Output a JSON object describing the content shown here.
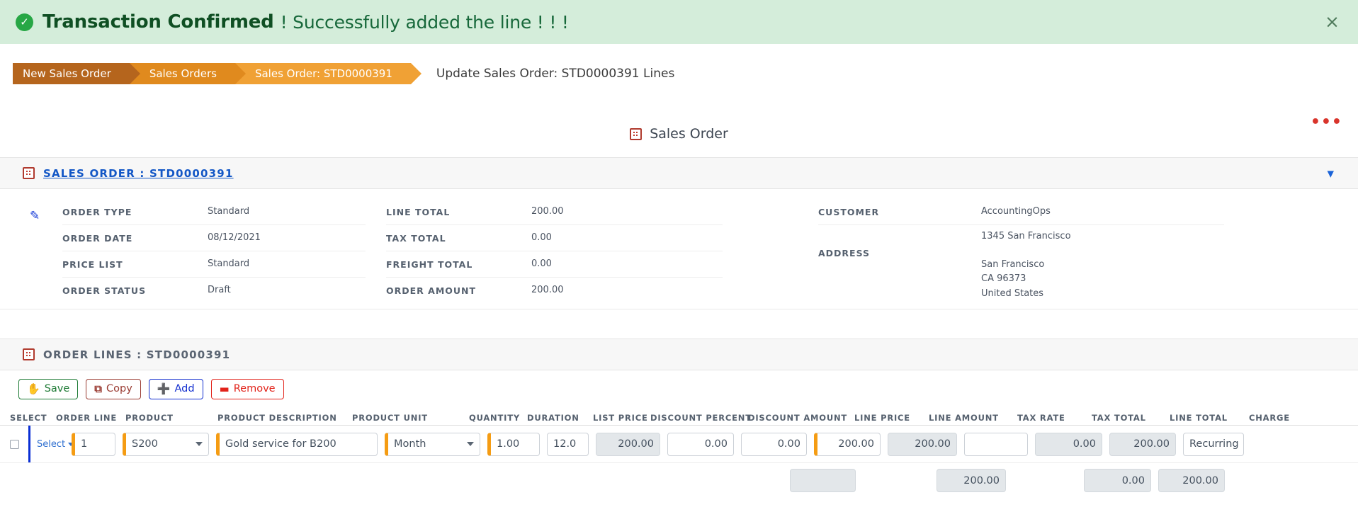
{
  "alert": {
    "icon": "check-circle-icon",
    "strong": "Transaction Confirmed",
    "message": "! Successfully added the line ! ! !",
    "close_label": "×",
    "bg_color": "#d4edda",
    "accent_color": "#27a745"
  },
  "breadcrumb": {
    "items": [
      {
        "label": "New Sales Order",
        "color": "#b5651d"
      },
      {
        "label": "Sales Orders",
        "color": "#e08a1e"
      },
      {
        "label": "Sales Order: STD0000391",
        "color": "#f0a135"
      }
    ],
    "current_page": "Update Sales Order: STD0000391 Lines"
  },
  "overflow_menu": {
    "label": "•••",
    "color": "#d9342b"
  },
  "tab": {
    "icon": "grid-icon",
    "label": "Sales Order"
  },
  "sales_order_card": {
    "icon": "grid-icon",
    "title": "SALES ORDER : STD0000391",
    "collapse_icon": "chevron-down-icon",
    "edit_icon": "pencil-icon",
    "column1": [
      {
        "label": "ORDER TYPE",
        "value": "Standard"
      },
      {
        "label": "ORDER DATE",
        "value": "08/12/2021"
      },
      {
        "label": "PRICE LIST",
        "value": "Standard"
      },
      {
        "label": "ORDER STATUS",
        "value": "Draft"
      }
    ],
    "column2": [
      {
        "label": "LINE TOTAL",
        "value": "200.00"
      },
      {
        "label": "TAX TOTAL",
        "value": "0.00"
      },
      {
        "label": "FREIGHT TOTAL",
        "value": "0.00"
      },
      {
        "label": "ORDER AMOUNT",
        "value": "200.00"
      }
    ],
    "column3": [
      {
        "label": "CUSTOMER",
        "value": "AccountingOps"
      },
      {
        "label": "",
        "value": "1345 San Francisco"
      },
      {
        "label": "ADDRESS",
        "value": "San Francisco\nCA 96373\nUnited States"
      }
    ]
  },
  "order_lines_card": {
    "icon": "grid-icon",
    "title": "ORDER LINES : STD0000391",
    "toolbar": [
      {
        "label": "Save",
        "icon": "save-icon",
        "color": "#1d7a34"
      },
      {
        "label": "Copy",
        "icon": "copy-icon",
        "color": "#9a3b32"
      },
      {
        "label": "Add",
        "icon": "plus-icon",
        "color": "#1430d0"
      },
      {
        "label": "Remove",
        "icon": "minus-icon",
        "color": "#e2231a"
      }
    ],
    "columns": [
      "SELECT",
      "ORDER LINE",
      "PRODUCT",
      "PRODUCT DESCRIPTION",
      "PRODUCT UNIT",
      "QUANTITY",
      "DURATION",
      "LIST PRICE",
      "DISCOUNT PERCENT",
      "DISCOUNT AMOUNT",
      "LINE PRICE",
      "LINE AMOUNT",
      "TAX RATE",
      "TAX TOTAL",
      "LINE TOTAL",
      "CHARGE"
    ],
    "row": {
      "select_checkbox": false,
      "select_link": "Select",
      "order_line": "1",
      "product": "S200",
      "product_description": "Gold service for B200",
      "product_unit": "Month",
      "quantity": "1.00",
      "duration": "12.0",
      "list_price": "200.00",
      "discount_percent": "0.00",
      "discount_amount": "0.00",
      "line_price": "200.00",
      "line_amount": "200.00",
      "tax_rate": "",
      "tax_total": "0.00",
      "line_total": "200.00",
      "charge": "Recurring"
    },
    "totals": {
      "discount_amount": "",
      "line_amount": "200.00",
      "tax_total": "0.00",
      "line_total": "200.00"
    }
  }
}
